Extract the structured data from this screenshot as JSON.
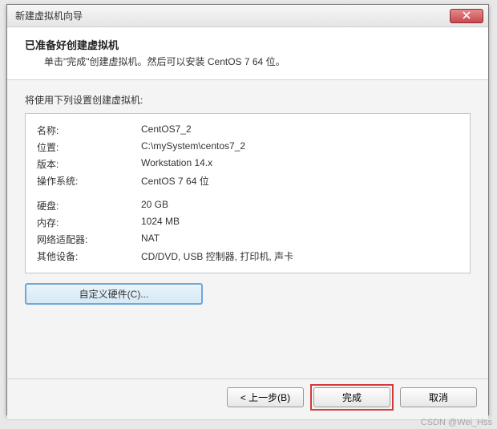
{
  "window": {
    "title": "新建虚拟机向导"
  },
  "header": {
    "title": "已准备好创建虚拟机",
    "subtitle": "单击\"完成\"创建虚拟机。然后可以安装 CentOS 7 64 位。"
  },
  "lead_text": "将使用下列设置创建虚拟机:",
  "summary": {
    "rows_a": [
      {
        "label": "名称:",
        "value": "CentOS7_2"
      },
      {
        "label": "位置:",
        "value": "C:\\mySystem\\centos7_2"
      },
      {
        "label": "版本:",
        "value": "Workstation 14.x"
      },
      {
        "label": "操作系统:",
        "value": "CentOS 7 64 位"
      }
    ],
    "rows_b": [
      {
        "label": "硬盘:",
        "value": "20 GB"
      },
      {
        "label": "内存:",
        "value": "1024 MB"
      },
      {
        "label": "网络适配器:",
        "value": "NAT"
      },
      {
        "label": "其他设备:",
        "value": "CD/DVD, USB 控制器, 打印机, 声卡"
      }
    ]
  },
  "buttons": {
    "customize": "自定义硬件(C)...",
    "back": "< 上一步(B)",
    "finish": "完成",
    "cancel": "取消"
  },
  "watermark": "CSDN @Wei_Hss"
}
